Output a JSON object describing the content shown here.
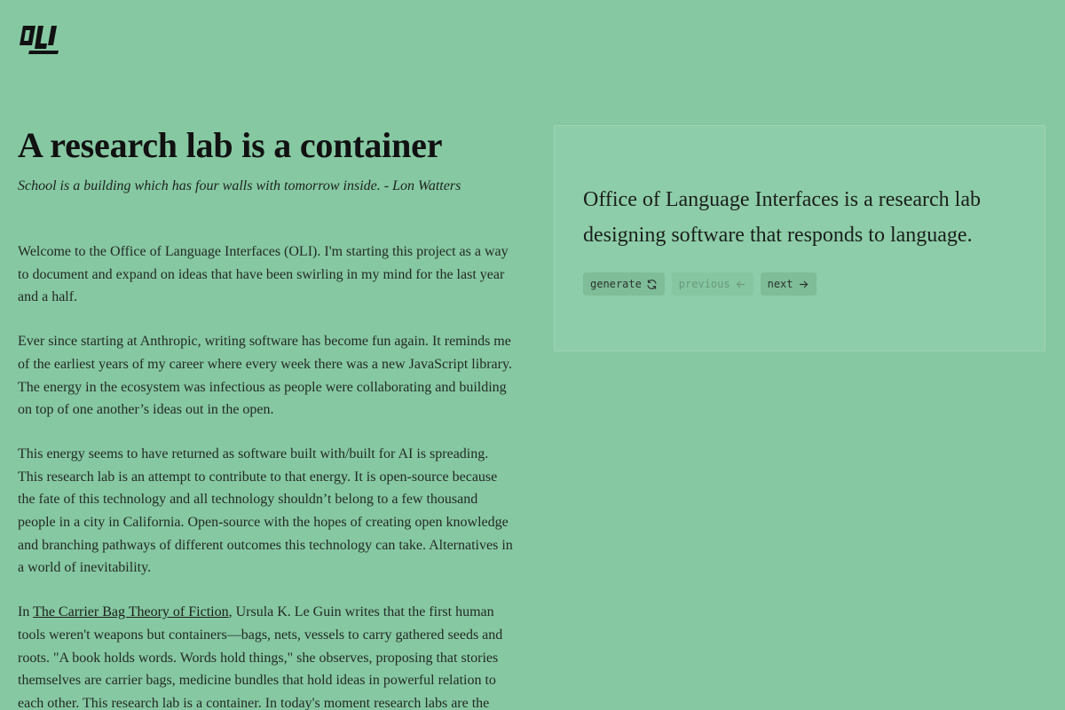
{
  "logo": {
    "text": "OLI",
    "icon": "oli-logo"
  },
  "article": {
    "title": "A research lab is a container",
    "tagline": "School is a building which has four walls with tomorrow inside. - Lon Watters",
    "paragraphs": [
      "Welcome to the Office of Language Interfaces (OLI). I'm starting this project as a way to document and expand on ideas that have been swirling in my mind for the last year and a half.",
      "Ever since starting at Anthropic, writing software has become fun again. It reminds me of the earliest years of my career where every week there was a new JavaScript library. The energy in the ecosystem was infectious as people were collaborating and building on top of one another’s ideas out in the open.",
      "This energy seems to have returned as software built with/built for AI is spreading. This research lab is an attempt to contribute to that energy. It is open-source because the fate of this technology and all technology shouldn’t belong to a few thousand people in a city in California. Open-source with the hopes of creating open knowledge and branching pathways of different outcomes this technology can take. Alternatives in a world of inevitability."
    ],
    "p4": {
      "prefix": "In ",
      "link_text": "The Carrier Bag Theory of Fiction",
      "suffix": ", Ursula K. Le Guin writes that the first human tools weren't weapons but containers—bags, nets, vessels to carry gathered seeds and roots. \"A book holds words. Words hold things,\" she observes, proposing that stories themselves are carrier bags, medicine bundles that hold ideas in powerful relation to each other. This research lab is a container. In today's moment research labs are the"
    }
  },
  "card": {
    "text": "Office of Language Interfaces is a research lab designing software that responds to language.",
    "buttons": {
      "generate": {
        "label": "generate",
        "icon": "refresh-icon",
        "enabled": true
      },
      "previous": {
        "label": "previous",
        "icon": "arrow-left-icon",
        "enabled": false
      },
      "next": {
        "label": "next",
        "icon": "arrow-right-icon",
        "enabled": true
      }
    }
  },
  "colors": {
    "background": "#86c8a2",
    "card_background": "#8ecda9",
    "button_background": "#7fbd99",
    "text": "#1a1f1c"
  }
}
